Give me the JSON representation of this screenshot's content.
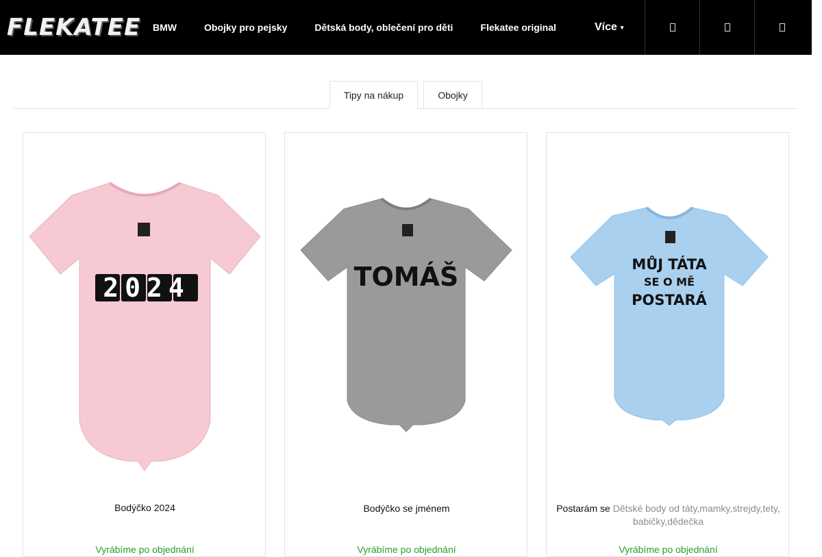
{
  "header": {
    "logo_text": "FLEKATEE",
    "nav": [
      "BMW",
      "Obojky pro pejsky",
      "Dětská body, oblečení pro děti",
      "Flekatee original"
    ],
    "more_label": "Více",
    "more_caret": "▾",
    "icons": [
      "search-icon",
      "user-icon",
      "cart-icon"
    ]
  },
  "tabs": [
    "Tipy na nákup",
    "Obojky"
  ],
  "products": [
    {
      "title": "Bodýčko 2024",
      "availability": "Vyrábíme po objednání",
      "print": "2024",
      "body_color": "#f6c9d3"
    },
    {
      "title": "Bodýčko se jménem",
      "availability": "Vyrábíme po objednání",
      "print": "TOMÁŠ",
      "body_color": "#9a9a9a"
    },
    {
      "title": "Postarám se",
      "category": "Dětské body od táty,mamky,strejdy,tety, babičky,dědečka",
      "availability": "Vyrábíme po objednání",
      "print_lines": [
        "MŮJ TÁTA",
        "SE O MĚ",
        "POSTARÁ"
      ],
      "body_color": "#a9d0ef"
    }
  ]
}
